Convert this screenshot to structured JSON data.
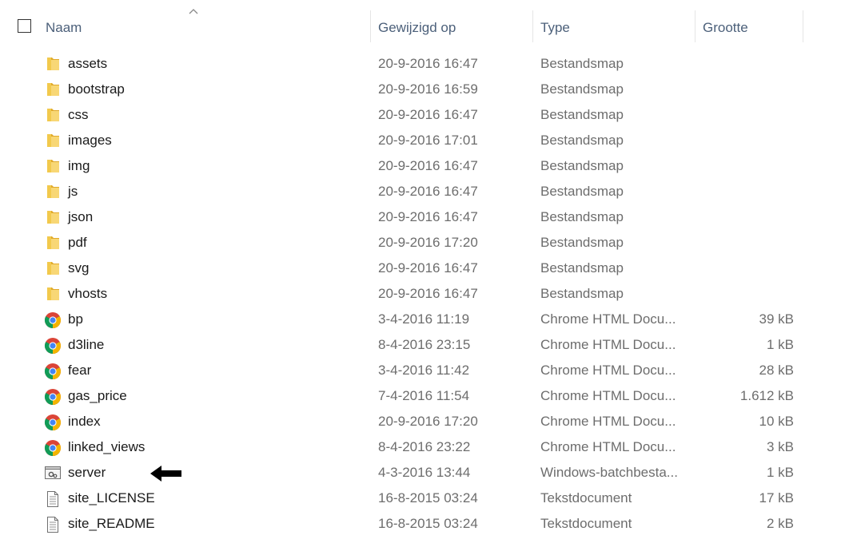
{
  "header": {
    "name": "Naam",
    "modified": "Gewijzigd op",
    "type": "Type",
    "size": "Grootte"
  },
  "files": [
    {
      "name": "assets",
      "modified": "20-9-2016 16:47",
      "type": "Bestandsmap",
      "size": "",
      "icon": "folder-icon"
    },
    {
      "name": "bootstrap",
      "modified": "20-9-2016 16:59",
      "type": "Bestandsmap",
      "size": "",
      "icon": "folder-icon"
    },
    {
      "name": "css",
      "modified": "20-9-2016 16:47",
      "type": "Bestandsmap",
      "size": "",
      "icon": "folder-icon"
    },
    {
      "name": "images",
      "modified": "20-9-2016 17:01",
      "type": "Bestandsmap",
      "size": "",
      "icon": "folder-icon"
    },
    {
      "name": "img",
      "modified": "20-9-2016 16:47",
      "type": "Bestandsmap",
      "size": "",
      "icon": "folder-icon"
    },
    {
      "name": "js",
      "modified": "20-9-2016 16:47",
      "type": "Bestandsmap",
      "size": "",
      "icon": "folder-icon"
    },
    {
      "name": "json",
      "modified": "20-9-2016 16:47",
      "type": "Bestandsmap",
      "size": "",
      "icon": "folder-icon"
    },
    {
      "name": "pdf",
      "modified": "20-9-2016 17:20",
      "type": "Bestandsmap",
      "size": "",
      "icon": "folder-icon"
    },
    {
      "name": "svg",
      "modified": "20-9-2016 16:47",
      "type": "Bestandsmap",
      "size": "",
      "icon": "folder-icon"
    },
    {
      "name": "vhosts",
      "modified": "20-9-2016 16:47",
      "type": "Bestandsmap",
      "size": "",
      "icon": "folder-icon"
    },
    {
      "name": "bp",
      "modified": "3-4-2016 11:19",
      "type": "Chrome HTML Docu...",
      "size": "39 kB",
      "icon": "chrome-icon"
    },
    {
      "name": "d3line",
      "modified": "8-4-2016 23:15",
      "type": "Chrome HTML Docu...",
      "size": "1 kB",
      "icon": "chrome-icon"
    },
    {
      "name": "fear",
      "modified": "3-4-2016 11:42",
      "type": "Chrome HTML Docu...",
      "size": "28 kB",
      "icon": "chrome-icon"
    },
    {
      "name": "gas_price",
      "modified": "7-4-2016 11:54",
      "type": "Chrome HTML Docu...",
      "size": "1.612 kB",
      "icon": "chrome-icon"
    },
    {
      "name": "index",
      "modified": "20-9-2016 17:20",
      "type": "Chrome HTML Docu...",
      "size": "10 kB",
      "icon": "chrome-icon"
    },
    {
      "name": "linked_views",
      "modified": "8-4-2016 23:22",
      "type": "Chrome HTML Docu...",
      "size": "3 kB",
      "icon": "chrome-icon"
    },
    {
      "name": "server",
      "modified": "4-3-2016 13:44",
      "type": "Windows-batchbesta...",
      "size": "1 kB",
      "icon": "batch-file-icon"
    },
    {
      "name": "site_LICENSE",
      "modified": "16-8-2015 03:24",
      "type": "Tekstdocument",
      "size": "17 kB",
      "icon": "text-file-icon"
    },
    {
      "name": "site_README",
      "modified": "16-8-2015 03:24",
      "type": "Tekstdocument",
      "size": "2 kB",
      "icon": "text-file-icon"
    }
  ],
  "colors": {
    "folder": "#f2c94c",
    "header_text": "#4c607a",
    "secondary_text": "#6d6d6d"
  }
}
